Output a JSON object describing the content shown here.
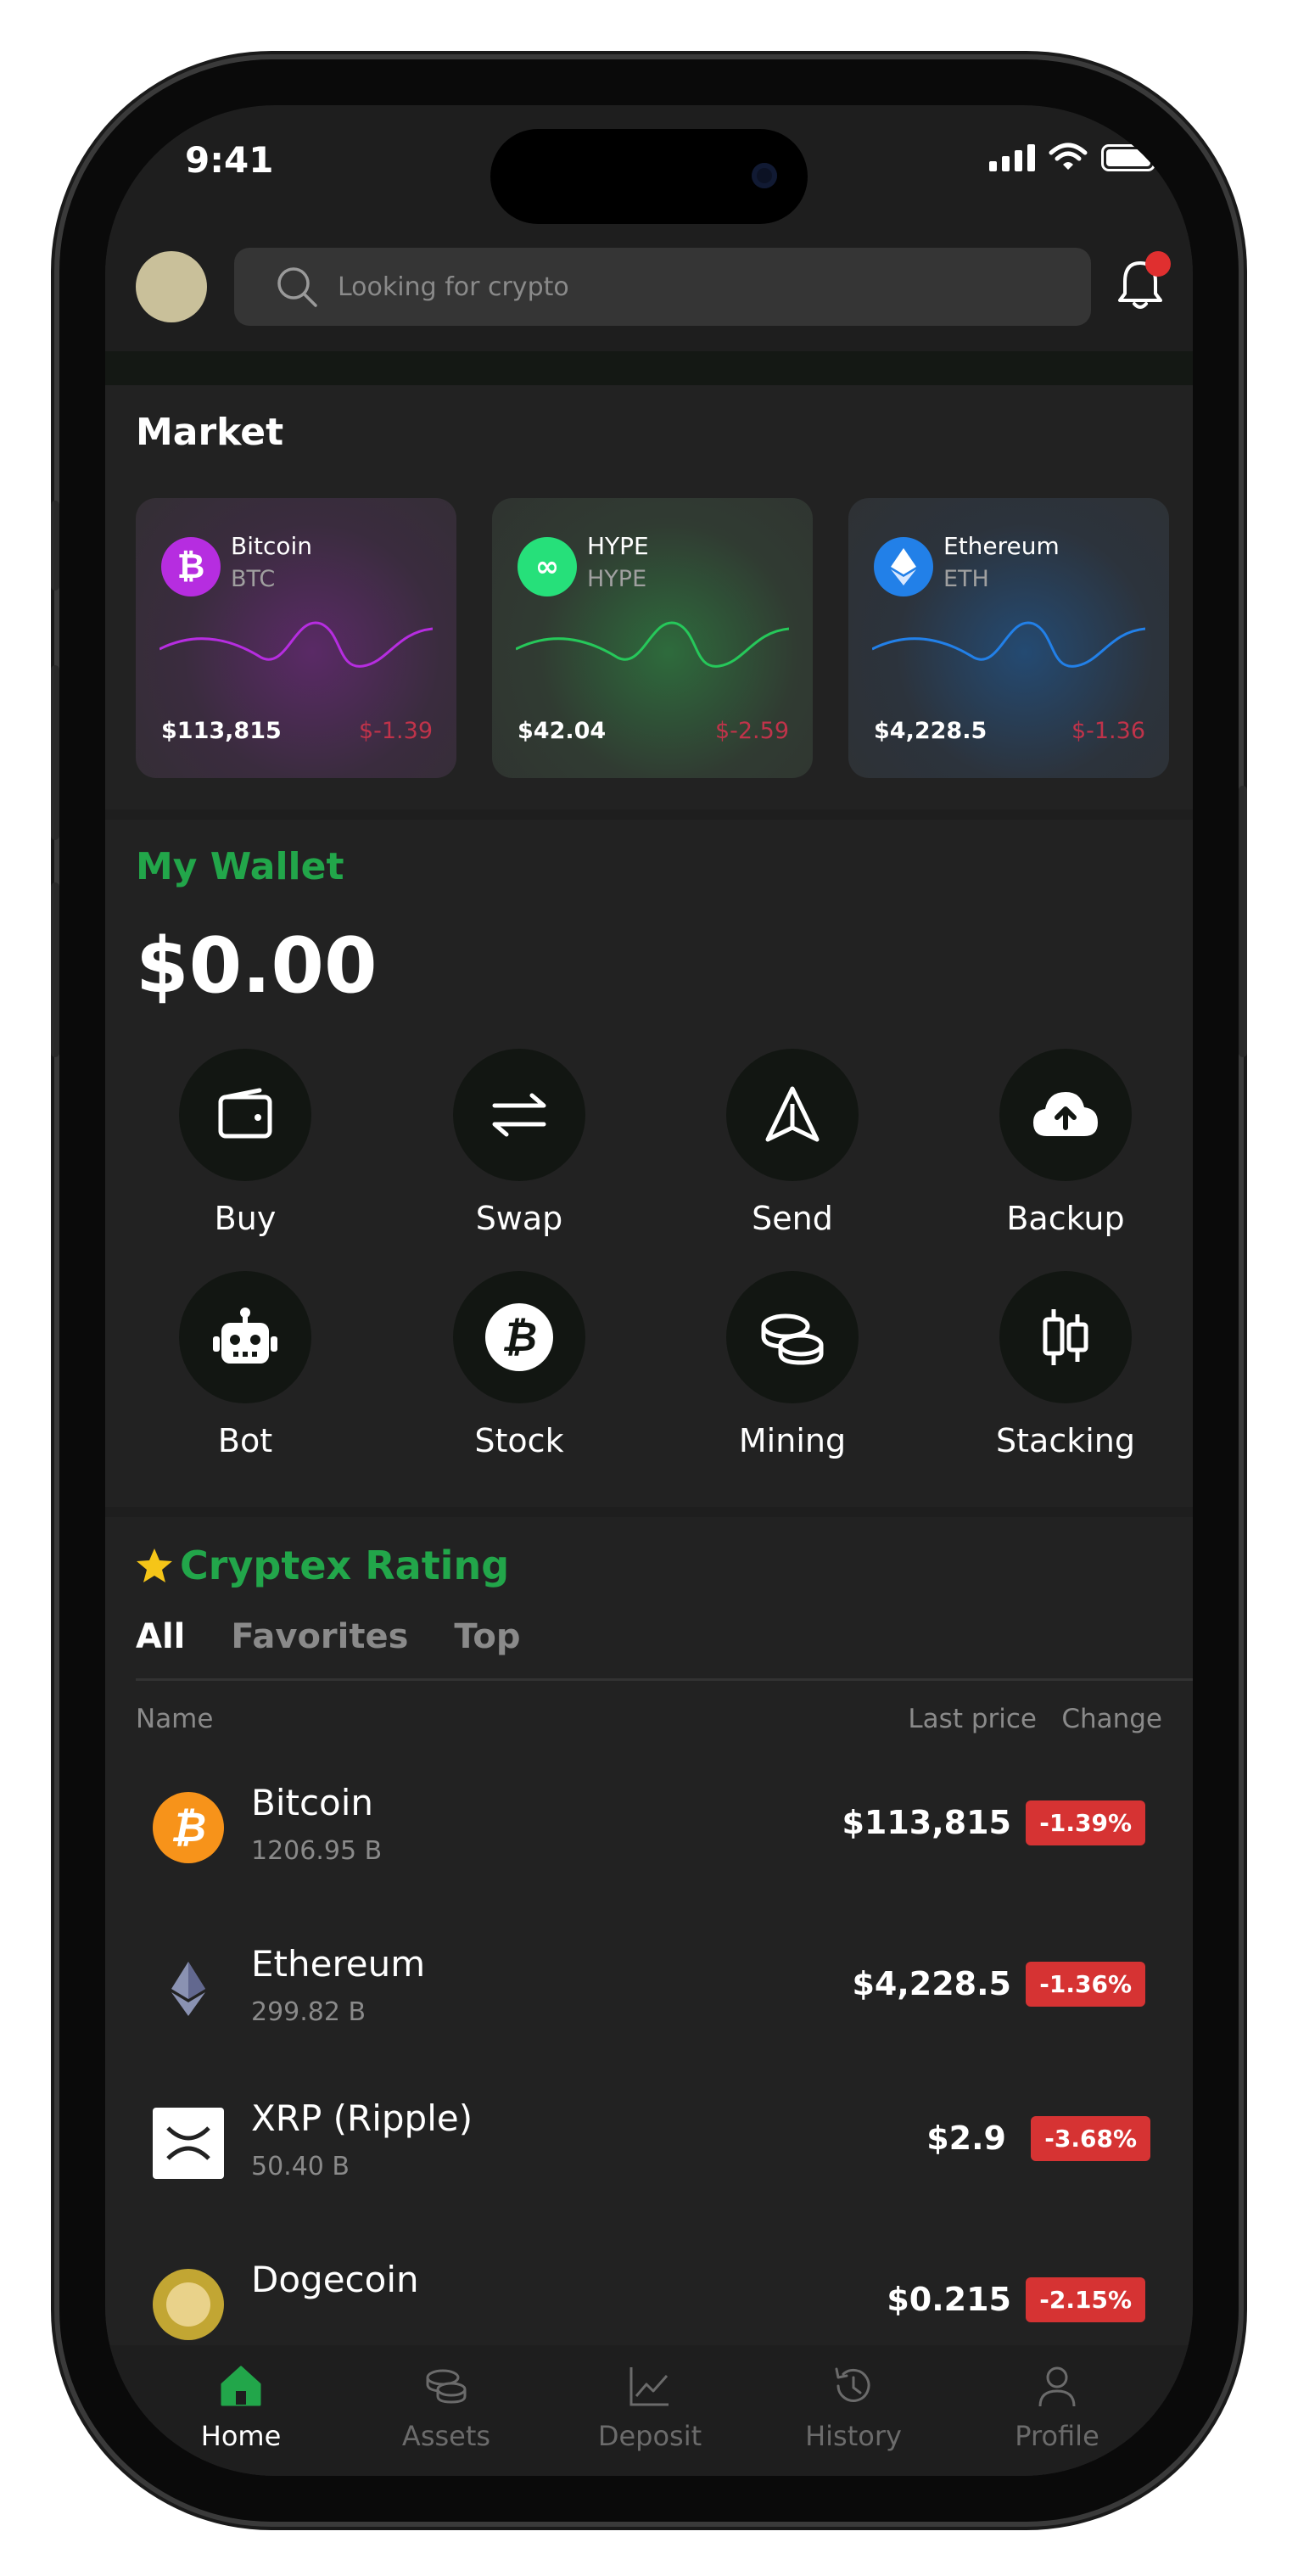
{
  "status": {
    "time": "9:41"
  },
  "search": {
    "placeholder": "Looking for crypto"
  },
  "market": {
    "title": "Market",
    "cards": [
      {
        "name": "Bitcoin",
        "symbol": "BTC",
        "price": "$113,815",
        "change": "$-1.39",
        "color": "#b62de0"
      },
      {
        "name": "HYPE",
        "symbol": "HYPE",
        "price": "$42.04",
        "change": "$-2.59",
        "color": "#26c85a"
      },
      {
        "name": "Ethereum",
        "symbol": "ETH",
        "price": "$4,228.5",
        "change": "$-1.36",
        "color": "#2280e8"
      }
    ]
  },
  "wallet": {
    "title": "My Wallet",
    "balance": "$0.00",
    "actions": [
      {
        "label": "Buy",
        "icon": "wallet-icon"
      },
      {
        "label": "Swap",
        "icon": "swap-icon"
      },
      {
        "label": "Send",
        "icon": "send-icon"
      },
      {
        "label": "Backup",
        "icon": "cloud-upload-icon"
      },
      {
        "label": "Bot",
        "icon": "robot-icon"
      },
      {
        "label": "Stock",
        "icon": "bitcoin-icon"
      },
      {
        "label": "Mining",
        "icon": "coins-icon"
      },
      {
        "label": "Stacking",
        "icon": "candlestick-icon"
      }
    ]
  },
  "rating": {
    "title": "Cryptex Rating",
    "tabs": [
      "All",
      "Favorites",
      "Top"
    ],
    "columns": {
      "name": "Name",
      "last_price": "Last price",
      "change": "Change"
    },
    "rows": [
      {
        "name": "Bitcoin",
        "cap": "1206.95 B",
        "price": "$113,815",
        "change": "-1.39%"
      },
      {
        "name": "Ethereum",
        "cap": "299.82 B",
        "price": "$4,228.5",
        "change": "-1.36%"
      },
      {
        "name": "XRP (Ripple)",
        "cap": "50.40 B",
        "price": "$2.9",
        "change": "-3.68%"
      },
      {
        "name": "Dogecoin",
        "cap": "",
        "price": "$0.215",
        "change": "-2.15%"
      }
    ]
  },
  "nav": {
    "items": [
      "Home",
      "Assets",
      "Deposit",
      "History",
      "Profile"
    ],
    "active": "Home",
    "accent": "#22a64a"
  }
}
